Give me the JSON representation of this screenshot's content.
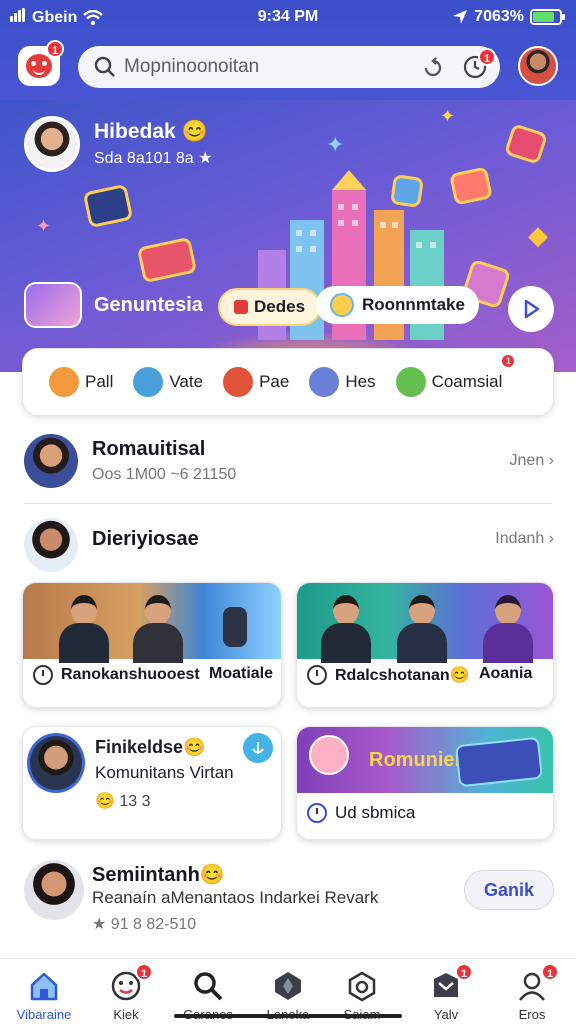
{
  "status_bar": {
    "carrier": "Gbein",
    "time": "9:34 PM",
    "battery_text": "7063%",
    "battery_level": 0.8
  },
  "header": {
    "app_badge": "1",
    "search_placeholder": "Mopninoonoitan",
    "notif_badge": "1"
  },
  "hero": {
    "name": "Hibedak 😊",
    "subtitle": "Sda 8a101 8a ★",
    "label": "Genuntesia",
    "pill_one": "Dedes",
    "pill_two": "Roonnmtake"
  },
  "categories": [
    {
      "label": "Pall",
      "color": "#f39a3c"
    },
    {
      "label": "Vate",
      "color": "#4aa0d8"
    },
    {
      "label": "Pae",
      "color": "#e2513a"
    },
    {
      "label": "Hes",
      "color": "#6a7fd8"
    },
    {
      "label": "Coamsial",
      "color": "#63c04f",
      "badge": "1"
    }
  ],
  "row_one": {
    "title": "Romauitisal",
    "subtitle": "Oos 1M00 ~6 21150",
    "action": "Jnen ›"
  },
  "row_two": {
    "title": "Dieriyiosae",
    "action": "Indanh ›"
  },
  "cards": {
    "c1": "Ranokanshuooest",
    "c1b": "Moatiale",
    "c2": "Rdalcshotanan😊",
    "c2b": "Aoania",
    "c3_title": "Finikeldse😊",
    "c3_sub": "Komunitans Virtan",
    "c3_meta": "😊 13 3",
    "c4_banner": "Romuniel",
    "c4_cap": "Ud sbmica"
  },
  "row_three": {
    "title": "Semiintanh😊",
    "subtitle": "Reanaín aMenantaos Indarkei Revark",
    "meta": "★ 91 8 82-510",
    "button": "Ganik"
  },
  "bottom_nav": [
    {
      "label": "Vibaraine",
      "icon": "home-icon",
      "active": true
    },
    {
      "label": "Kiek",
      "icon": "face-icon",
      "badge": "1"
    },
    {
      "label": "Garanes",
      "icon": "search-icon"
    },
    {
      "label": "Lanoka",
      "icon": "gem-icon"
    },
    {
      "label": "Saiam",
      "icon": "camera-icon"
    },
    {
      "label": "Yalv",
      "icon": "bag-icon",
      "badge": "1"
    },
    {
      "label": "Eros",
      "icon": "person-icon",
      "badge": "1"
    }
  ],
  "colors": {
    "brand": "#3a4fc9",
    "accent": "#2d58d6",
    "badge": "#e8323a"
  }
}
